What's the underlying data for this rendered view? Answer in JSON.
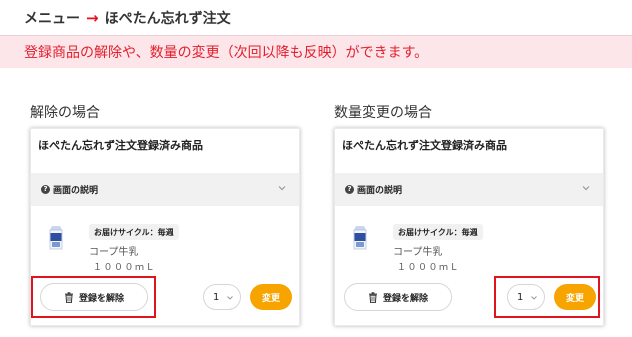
{
  "breadcrumb": {
    "menu": "メニュー",
    "arrow": "→",
    "current": "ほぺたん忘れず注文"
  },
  "notice": "登録商品の解除や、数量の変更（次回以降も反映）ができます。",
  "colors": {
    "accent_red": "#e21e2d",
    "notice_bg": "#fde6ea",
    "change_button": "#f7a400",
    "highlight": "#e0141e"
  },
  "panels": [
    {
      "section_title": "解除の場合",
      "card_title": "ほぺたん忘れず注文登録済み商品",
      "accordion_label": "画面の説明",
      "cycle_badge": "お届けサイクル：毎週",
      "product_name": "コープ牛乳",
      "product_volume": "１０００ｍＬ",
      "remove_label": "登録を解除",
      "quantity": "1",
      "change_label": "変更",
      "highlighted": "remove-button"
    },
    {
      "section_title": "数量変更の場合",
      "card_title": "ほぺたん忘れず注文登録済み商品",
      "accordion_label": "画面の説明",
      "cycle_badge": "お届けサイクル：毎週",
      "product_name": "コープ牛乳",
      "product_volume": "１０００ｍＬ",
      "remove_label": "登録を解除",
      "quantity": "1",
      "change_label": "変更",
      "highlighted": "quantity-and-change"
    }
  ],
  "icons": {
    "accordion": "question-circle-icon",
    "chevron": "chevron-down-icon",
    "remove": "trash-icon",
    "product": "milk-carton-image"
  }
}
